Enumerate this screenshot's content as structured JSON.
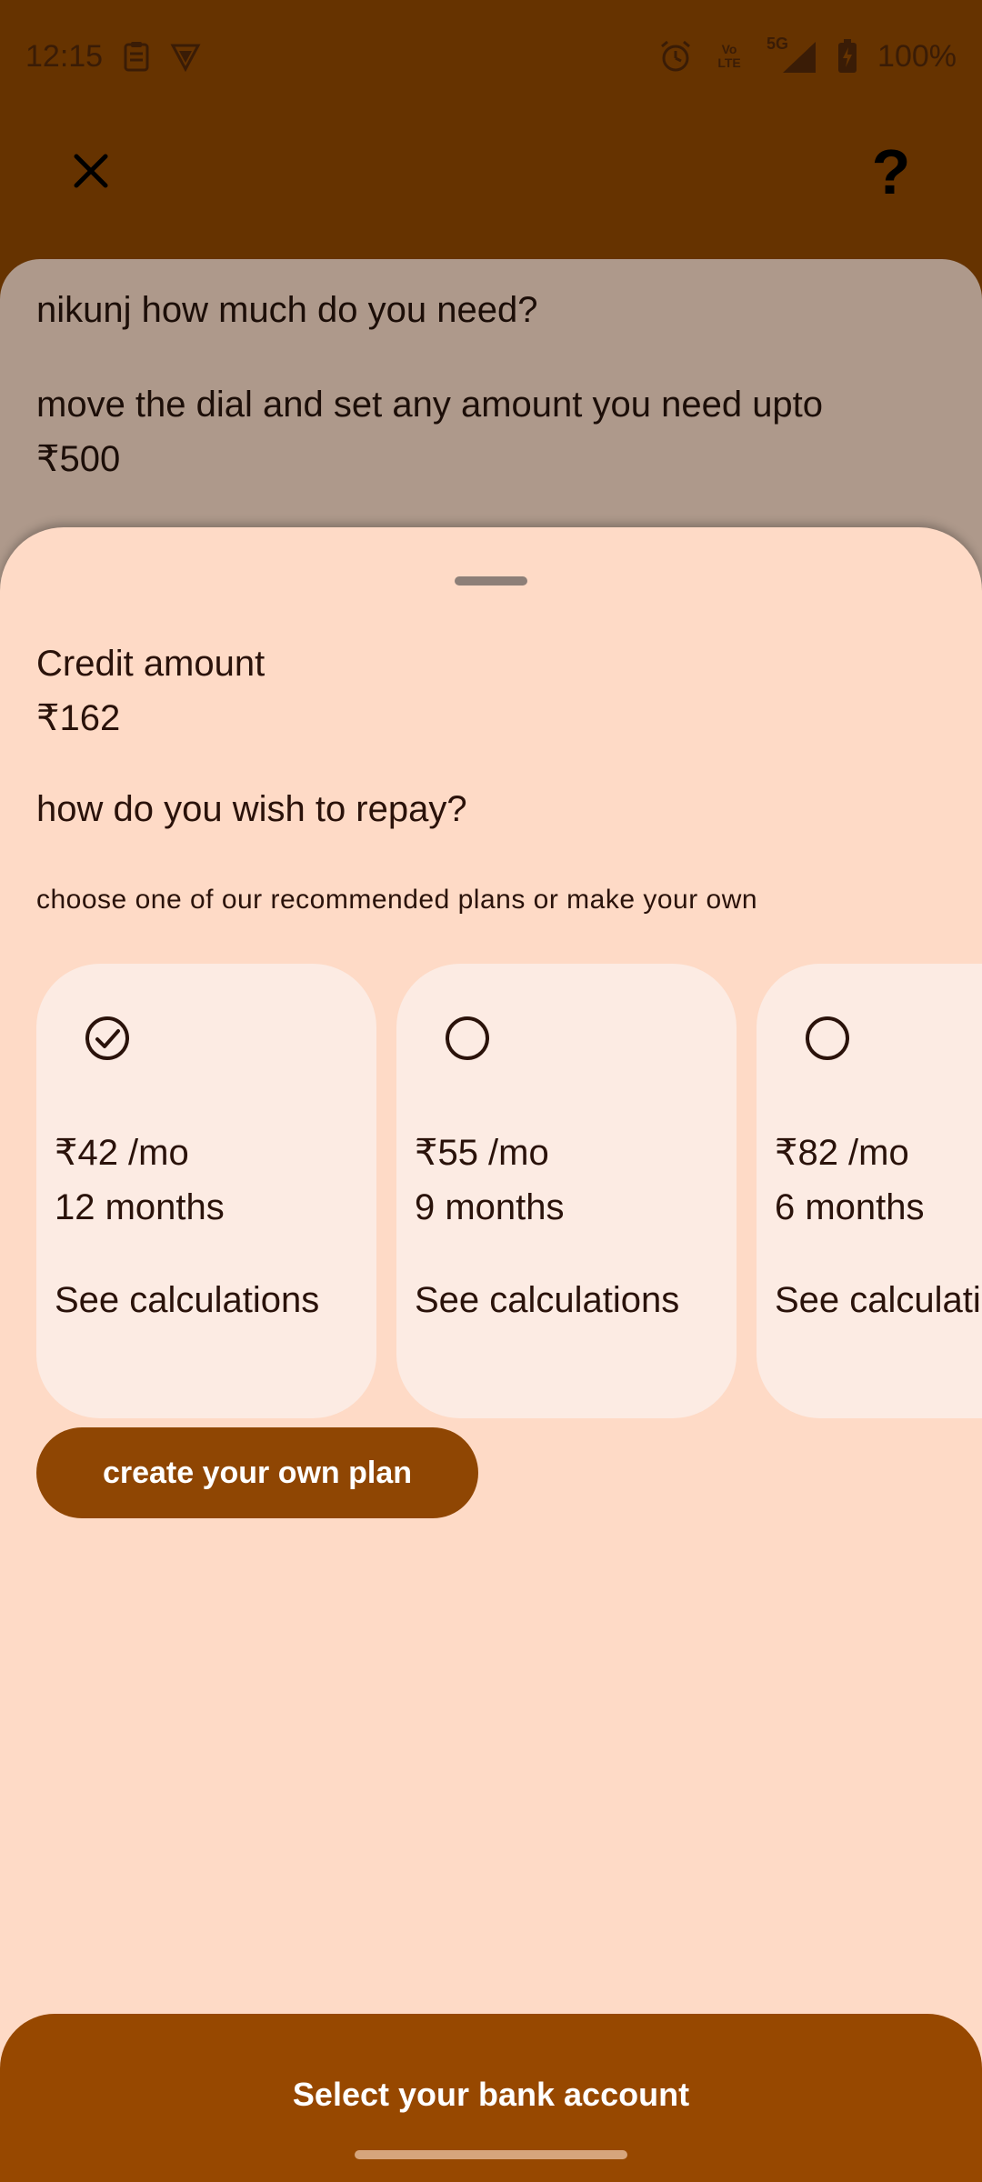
{
  "status_bar": {
    "time": "12:15",
    "battery": "100%",
    "icons": [
      "clipboard-icon",
      "shield-icon",
      "alarm-icon",
      "volte-icon",
      "signal-5g-icon",
      "battery-charging-icon"
    ],
    "volte_label": "Vo LTE",
    "network_label": "5G"
  },
  "top_bar": {
    "close_icon": "close-icon",
    "help_label": "?"
  },
  "background_card": {
    "question": "nikunj how much do you need?",
    "instruction": "move the dial and set any amount you need upto ₹500"
  },
  "sheet": {
    "credit_label": "Credit amount",
    "credit_value": "₹162",
    "repay_question": "how do you wish to repay?",
    "repay_subtitle": "choose one of our recommended plans or make your own",
    "plans": [
      {
        "amount": "₹42 /mo",
        "duration": "12 months",
        "link": "See calculations",
        "selected": true
      },
      {
        "amount": "₹55 /mo",
        "duration": "9 months",
        "link": "See calculations",
        "selected": false
      },
      {
        "amount": "₹82 /mo",
        "duration": "6 months",
        "link": "See calculations",
        "selected": false
      }
    ],
    "create_plan_label": "create your own plan"
  },
  "footer": {
    "bank_button_label": "Select your bank account"
  },
  "colors": {
    "header_bg": "#663300",
    "sheet_bg": "#fedac6",
    "card_bg": "#fcebe3",
    "primary_button": "#8f4603",
    "footer_button": "#974800"
  }
}
